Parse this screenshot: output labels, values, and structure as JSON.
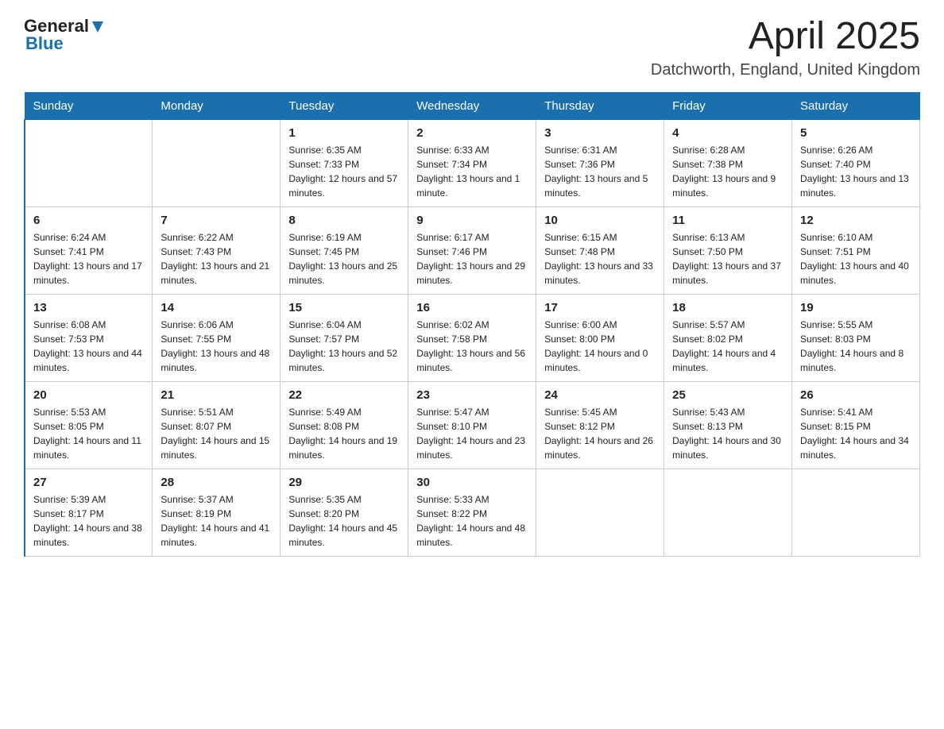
{
  "header": {
    "logo_general": "General",
    "logo_blue": "Blue",
    "month_title": "April 2025",
    "location": "Datchworth, England, United Kingdom"
  },
  "columns": [
    "Sunday",
    "Monday",
    "Tuesday",
    "Wednesday",
    "Thursday",
    "Friday",
    "Saturday"
  ],
  "weeks": [
    [
      {
        "day": "",
        "sunrise": "",
        "sunset": "",
        "daylight": ""
      },
      {
        "day": "",
        "sunrise": "",
        "sunset": "",
        "daylight": ""
      },
      {
        "day": "1",
        "sunrise": "Sunrise: 6:35 AM",
        "sunset": "Sunset: 7:33 PM",
        "daylight": "Daylight: 12 hours and 57 minutes."
      },
      {
        "day": "2",
        "sunrise": "Sunrise: 6:33 AM",
        "sunset": "Sunset: 7:34 PM",
        "daylight": "Daylight: 13 hours and 1 minute."
      },
      {
        "day": "3",
        "sunrise": "Sunrise: 6:31 AM",
        "sunset": "Sunset: 7:36 PM",
        "daylight": "Daylight: 13 hours and 5 minutes."
      },
      {
        "day": "4",
        "sunrise": "Sunrise: 6:28 AM",
        "sunset": "Sunset: 7:38 PM",
        "daylight": "Daylight: 13 hours and 9 minutes."
      },
      {
        "day": "5",
        "sunrise": "Sunrise: 6:26 AM",
        "sunset": "Sunset: 7:40 PM",
        "daylight": "Daylight: 13 hours and 13 minutes."
      }
    ],
    [
      {
        "day": "6",
        "sunrise": "Sunrise: 6:24 AM",
        "sunset": "Sunset: 7:41 PM",
        "daylight": "Daylight: 13 hours and 17 minutes."
      },
      {
        "day": "7",
        "sunrise": "Sunrise: 6:22 AM",
        "sunset": "Sunset: 7:43 PM",
        "daylight": "Daylight: 13 hours and 21 minutes."
      },
      {
        "day": "8",
        "sunrise": "Sunrise: 6:19 AM",
        "sunset": "Sunset: 7:45 PM",
        "daylight": "Daylight: 13 hours and 25 minutes."
      },
      {
        "day": "9",
        "sunrise": "Sunrise: 6:17 AM",
        "sunset": "Sunset: 7:46 PM",
        "daylight": "Daylight: 13 hours and 29 minutes."
      },
      {
        "day": "10",
        "sunrise": "Sunrise: 6:15 AM",
        "sunset": "Sunset: 7:48 PM",
        "daylight": "Daylight: 13 hours and 33 minutes."
      },
      {
        "day": "11",
        "sunrise": "Sunrise: 6:13 AM",
        "sunset": "Sunset: 7:50 PM",
        "daylight": "Daylight: 13 hours and 37 minutes."
      },
      {
        "day": "12",
        "sunrise": "Sunrise: 6:10 AM",
        "sunset": "Sunset: 7:51 PM",
        "daylight": "Daylight: 13 hours and 40 minutes."
      }
    ],
    [
      {
        "day": "13",
        "sunrise": "Sunrise: 6:08 AM",
        "sunset": "Sunset: 7:53 PM",
        "daylight": "Daylight: 13 hours and 44 minutes."
      },
      {
        "day": "14",
        "sunrise": "Sunrise: 6:06 AM",
        "sunset": "Sunset: 7:55 PM",
        "daylight": "Daylight: 13 hours and 48 minutes."
      },
      {
        "day": "15",
        "sunrise": "Sunrise: 6:04 AM",
        "sunset": "Sunset: 7:57 PM",
        "daylight": "Daylight: 13 hours and 52 minutes."
      },
      {
        "day": "16",
        "sunrise": "Sunrise: 6:02 AM",
        "sunset": "Sunset: 7:58 PM",
        "daylight": "Daylight: 13 hours and 56 minutes."
      },
      {
        "day": "17",
        "sunrise": "Sunrise: 6:00 AM",
        "sunset": "Sunset: 8:00 PM",
        "daylight": "Daylight: 14 hours and 0 minutes."
      },
      {
        "day": "18",
        "sunrise": "Sunrise: 5:57 AM",
        "sunset": "Sunset: 8:02 PM",
        "daylight": "Daylight: 14 hours and 4 minutes."
      },
      {
        "day": "19",
        "sunrise": "Sunrise: 5:55 AM",
        "sunset": "Sunset: 8:03 PM",
        "daylight": "Daylight: 14 hours and 8 minutes."
      }
    ],
    [
      {
        "day": "20",
        "sunrise": "Sunrise: 5:53 AM",
        "sunset": "Sunset: 8:05 PM",
        "daylight": "Daylight: 14 hours and 11 minutes."
      },
      {
        "day": "21",
        "sunrise": "Sunrise: 5:51 AM",
        "sunset": "Sunset: 8:07 PM",
        "daylight": "Daylight: 14 hours and 15 minutes."
      },
      {
        "day": "22",
        "sunrise": "Sunrise: 5:49 AM",
        "sunset": "Sunset: 8:08 PM",
        "daylight": "Daylight: 14 hours and 19 minutes."
      },
      {
        "day": "23",
        "sunrise": "Sunrise: 5:47 AM",
        "sunset": "Sunset: 8:10 PM",
        "daylight": "Daylight: 14 hours and 23 minutes."
      },
      {
        "day": "24",
        "sunrise": "Sunrise: 5:45 AM",
        "sunset": "Sunset: 8:12 PM",
        "daylight": "Daylight: 14 hours and 26 minutes."
      },
      {
        "day": "25",
        "sunrise": "Sunrise: 5:43 AM",
        "sunset": "Sunset: 8:13 PM",
        "daylight": "Daylight: 14 hours and 30 minutes."
      },
      {
        "day": "26",
        "sunrise": "Sunrise: 5:41 AM",
        "sunset": "Sunset: 8:15 PM",
        "daylight": "Daylight: 14 hours and 34 minutes."
      }
    ],
    [
      {
        "day": "27",
        "sunrise": "Sunrise: 5:39 AM",
        "sunset": "Sunset: 8:17 PM",
        "daylight": "Daylight: 14 hours and 38 minutes."
      },
      {
        "day": "28",
        "sunrise": "Sunrise: 5:37 AM",
        "sunset": "Sunset: 8:19 PM",
        "daylight": "Daylight: 14 hours and 41 minutes."
      },
      {
        "day": "29",
        "sunrise": "Sunrise: 5:35 AM",
        "sunset": "Sunset: 8:20 PM",
        "daylight": "Daylight: 14 hours and 45 minutes."
      },
      {
        "day": "30",
        "sunrise": "Sunrise: 5:33 AM",
        "sunset": "Sunset: 8:22 PM",
        "daylight": "Daylight: 14 hours and 48 minutes."
      },
      {
        "day": "",
        "sunrise": "",
        "sunset": "",
        "daylight": ""
      },
      {
        "day": "",
        "sunrise": "",
        "sunset": "",
        "daylight": ""
      },
      {
        "day": "",
        "sunrise": "",
        "sunset": "",
        "daylight": ""
      }
    ]
  ]
}
